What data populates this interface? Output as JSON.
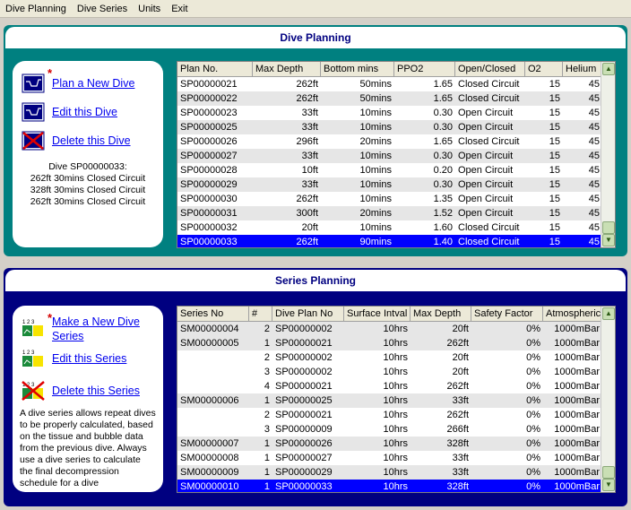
{
  "menu": [
    "Dive Planning",
    "Dive Series",
    "Units",
    "Exit"
  ],
  "dive_panel": {
    "title": "Dive Planning",
    "actions": {
      "plan_new": "Plan a New Dive",
      "edit": "Edit this Dive",
      "delete": "Delete this Dive"
    },
    "summary": [
      "Dive SP00000033:",
      "262ft 30mins Closed Circuit",
      "328ft 30mins Closed Circuit",
      "262ft 30mins Closed Circuit"
    ],
    "columns": [
      "Plan No.",
      "Max Depth",
      "Bottom mins",
      "PPO2",
      "Open/Closed",
      "O2",
      "Helium"
    ],
    "rows": [
      [
        "SP00000021",
        "262ft",
        "50mins",
        "1.65",
        "Closed Circuit",
        "15",
        "45"
      ],
      [
        "SP00000022",
        "262ft",
        "50mins",
        "1.65",
        "Closed Circuit",
        "15",
        "45"
      ],
      [
        "SP00000023",
        "33ft",
        "10mins",
        "0.30",
        "Open Circuit",
        "15",
        "45"
      ],
      [
        "SP00000025",
        "33ft",
        "10mins",
        "0.30",
        "Open Circuit",
        "15",
        "45"
      ],
      [
        "SP00000026",
        "296ft",
        "20mins",
        "1.65",
        "Closed Circuit",
        "15",
        "45"
      ],
      [
        "SP00000027",
        "33ft",
        "10mins",
        "0.30",
        "Open Circuit",
        "15",
        "45"
      ],
      [
        "SP00000028",
        "10ft",
        "10mins",
        "0.20",
        "Open Circuit",
        "15",
        "45"
      ],
      [
        "SP00000029",
        "33ft",
        "10mins",
        "0.30",
        "Open Circuit",
        "15",
        "45"
      ],
      [
        "SP00000030",
        "262ft",
        "10mins",
        "1.35",
        "Open Circuit",
        "15",
        "45"
      ],
      [
        "SP00000031",
        "300ft",
        "20mins",
        "1.52",
        "Open Circuit",
        "15",
        "45"
      ],
      [
        "SP00000032",
        "20ft",
        "10mins",
        "1.60",
        "Closed Circuit",
        "15",
        "45"
      ],
      [
        "SP00000033",
        "262ft",
        "90mins",
        "1.40",
        "Closed Circuit",
        "15",
        "45"
      ]
    ],
    "selected_row": 11
  },
  "series_panel": {
    "title": "Series Planning",
    "actions": {
      "make_new_1": "Make a New Dive",
      "make_new_2": "Series",
      "edit": "Edit this Series",
      "delete": "Delete this Series"
    },
    "info": [
      "A dive series allows repeat dives",
      "to be properly calculated, based",
      "on the tissue and bubble data",
      "from the previous dive. Always",
      "use a dive series to calculate",
      "the final decompression",
      "schedule for a dive"
    ],
    "columns": [
      "Series No",
      "#",
      "Dive Plan No",
      "Surface Intval",
      "Max Depth",
      "Safety Factor",
      "Atmospheric"
    ],
    "rows": [
      [
        "SM00000004",
        "2",
        "SP00000002",
        "10hrs",
        "20ft",
        "0%",
        "1000mBar"
      ],
      [
        "SM00000005",
        "1",
        "SP00000021",
        "10hrs",
        "262ft",
        "0%",
        "1000mBar"
      ],
      [
        "",
        "2",
        "SP00000002",
        "10hrs",
        "20ft",
        "0%",
        "1000mBar"
      ],
      [
        "",
        "3",
        "SP00000002",
        "10hrs",
        "20ft",
        "0%",
        "1000mBar"
      ],
      [
        "",
        "4",
        "SP00000021",
        "10hrs",
        "262ft",
        "0%",
        "1000mBar"
      ],
      [
        "SM00000006",
        "1",
        "SP00000025",
        "10hrs",
        "33ft",
        "0%",
        "1000mBar"
      ],
      [
        "",
        "2",
        "SP00000021",
        "10hrs",
        "262ft",
        "0%",
        "1000mBar"
      ],
      [
        "",
        "3",
        "SP00000009",
        "10hrs",
        "266ft",
        "0%",
        "1000mBar"
      ],
      [
        "SM00000007",
        "1",
        "SP00000026",
        "10hrs",
        "328ft",
        "0%",
        "1000mBar"
      ],
      [
        "SM00000008",
        "1",
        "SP00000027",
        "10hrs",
        "33ft",
        "0%",
        "1000mBar"
      ],
      [
        "SM00000009",
        "1",
        "SP00000029",
        "10hrs",
        "33ft",
        "0%",
        "1000mBar"
      ],
      [
        "SM00000010",
        "1",
        "SP00000033",
        "10hrs",
        "328ft",
        "0%",
        "1000mBar"
      ]
    ],
    "row_shading": [
      "alt",
      "alt",
      "",
      "",
      "",
      "alt",
      "",
      "",
      "alt",
      "",
      "alt",
      "sel"
    ]
  },
  "colors": {
    "teal": "#008080",
    "navy": "#000080",
    "select": "#0000ff",
    "link": "#0000ee"
  }
}
